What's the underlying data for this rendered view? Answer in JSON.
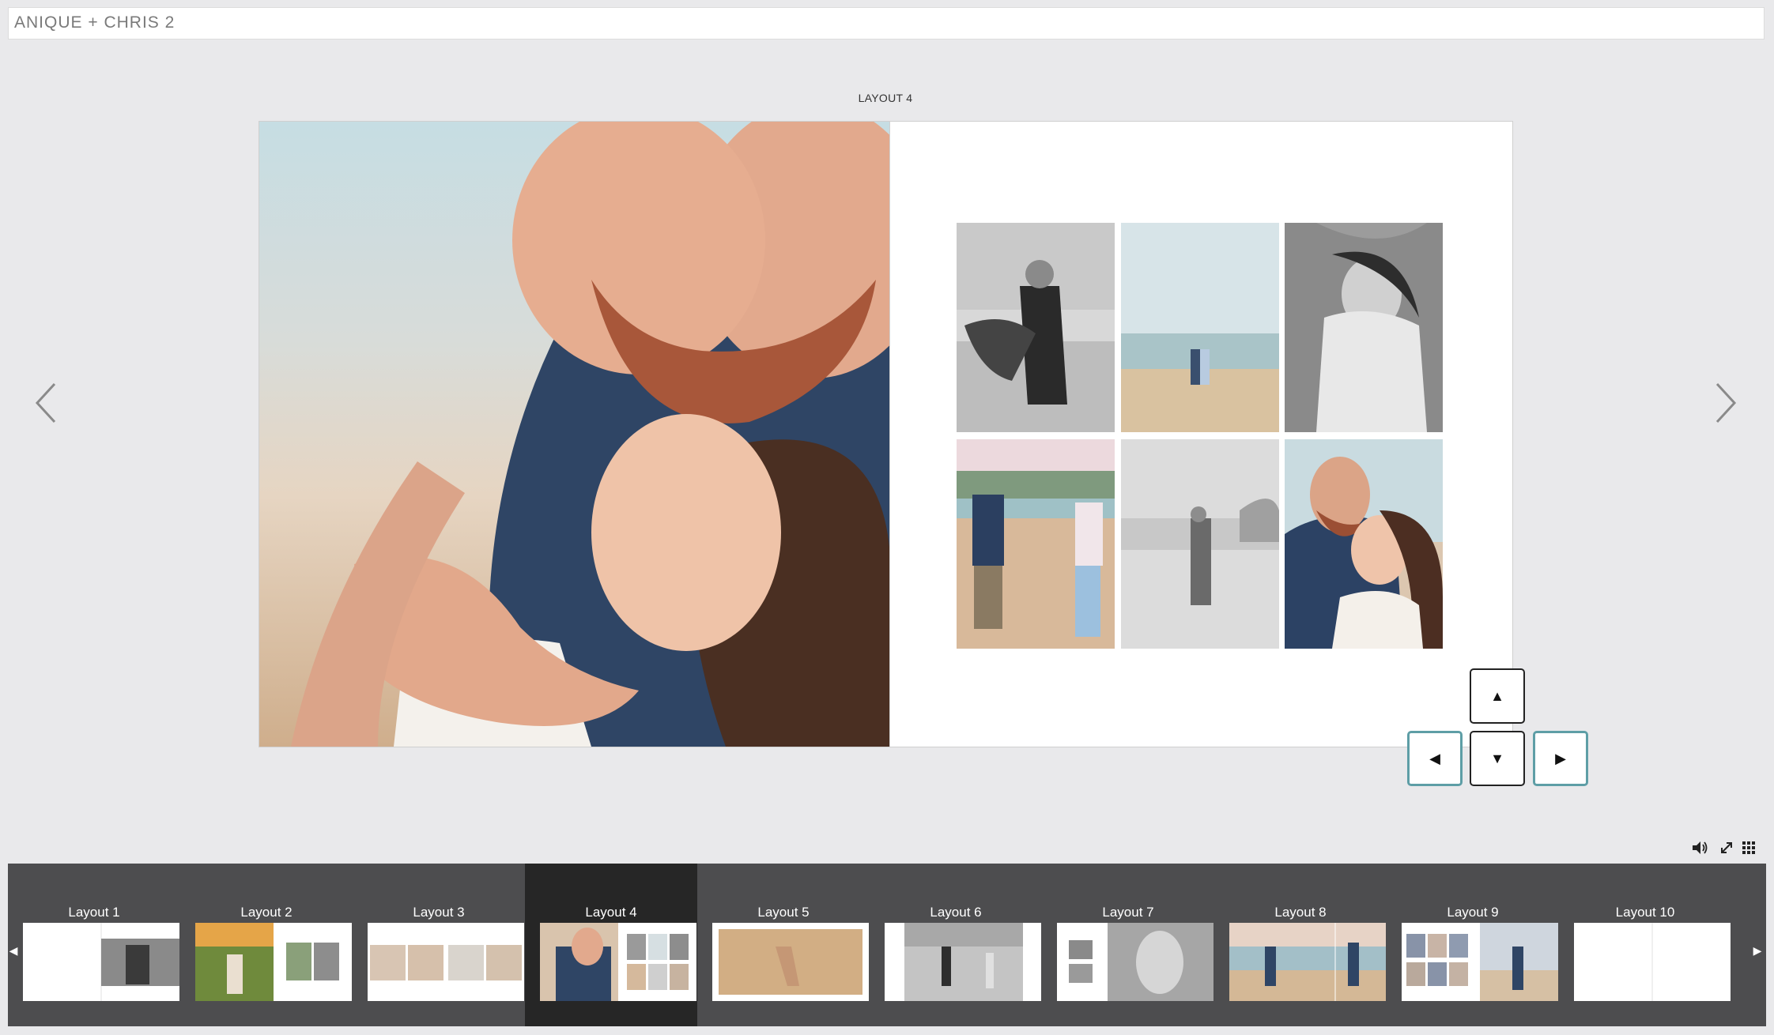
{
  "app": {
    "title": "ANIQUE + CHRIS 2"
  },
  "spread": {
    "layout_label": "LAYOUT 4"
  },
  "navigation": {
    "prev_icon": "chevron-left-icon",
    "next_icon": "chevron-right-icon"
  },
  "keypad": {
    "up": "▲",
    "down": "▼",
    "left": "◀",
    "right": "▶"
  },
  "tools": {
    "sound_icon": "speaker-icon",
    "fullscreen_icon": "expand-icon",
    "grid_icon": "grid-icon"
  },
  "thumbnails": [
    {
      "label": "Layout 1"
    },
    {
      "label": "Layout 2"
    },
    {
      "label": "Layout 3"
    },
    {
      "label": "Layout 4",
      "selected": true
    },
    {
      "label": "Layout 5"
    },
    {
      "label": "Layout 6"
    },
    {
      "label": "Layout 7"
    },
    {
      "label": "Layout 8"
    },
    {
      "label": "Layout 9"
    },
    {
      "label": "Layout 10"
    }
  ],
  "strip": {
    "prev_arrow": "◀",
    "next_arrow": "▶"
  },
  "colors": {
    "accent": "#5e9ea6",
    "strip_bg": "#4d4d4f",
    "strip_active": "#262626",
    "page_bg": "#e9e9eb"
  }
}
